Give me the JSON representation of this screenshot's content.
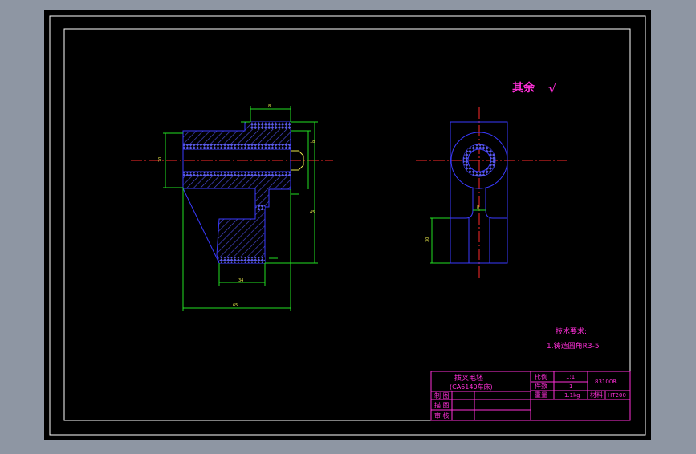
{
  "roughness_note": {
    "label": "其余",
    "symbol": "√"
  },
  "tech_requirements": {
    "title": "技术要求:",
    "item_1": "1.铸造圆角R3-5"
  },
  "dimensions": {
    "top_width": "8",
    "left_height": "20",
    "right_small": "18",
    "overall_height": "45",
    "base_width": "34",
    "overall_width": "65",
    "side_height": "30",
    "side_top": "8"
  },
  "title_block": {
    "part_name_line1": "拨叉毛坯",
    "part_name_line2": "(CA6140车床)",
    "scale_label": "比例",
    "scale_value": "1:1",
    "qty_label": "件数",
    "qty_value": "1",
    "weight_label": "重量",
    "weight_value": "1.1kg",
    "material_label": "材料",
    "material_value": "HT200",
    "drawing_no": "831008",
    "drawn_by": "制 图",
    "described_by": "描 图",
    "checked_by": "审 核"
  }
}
